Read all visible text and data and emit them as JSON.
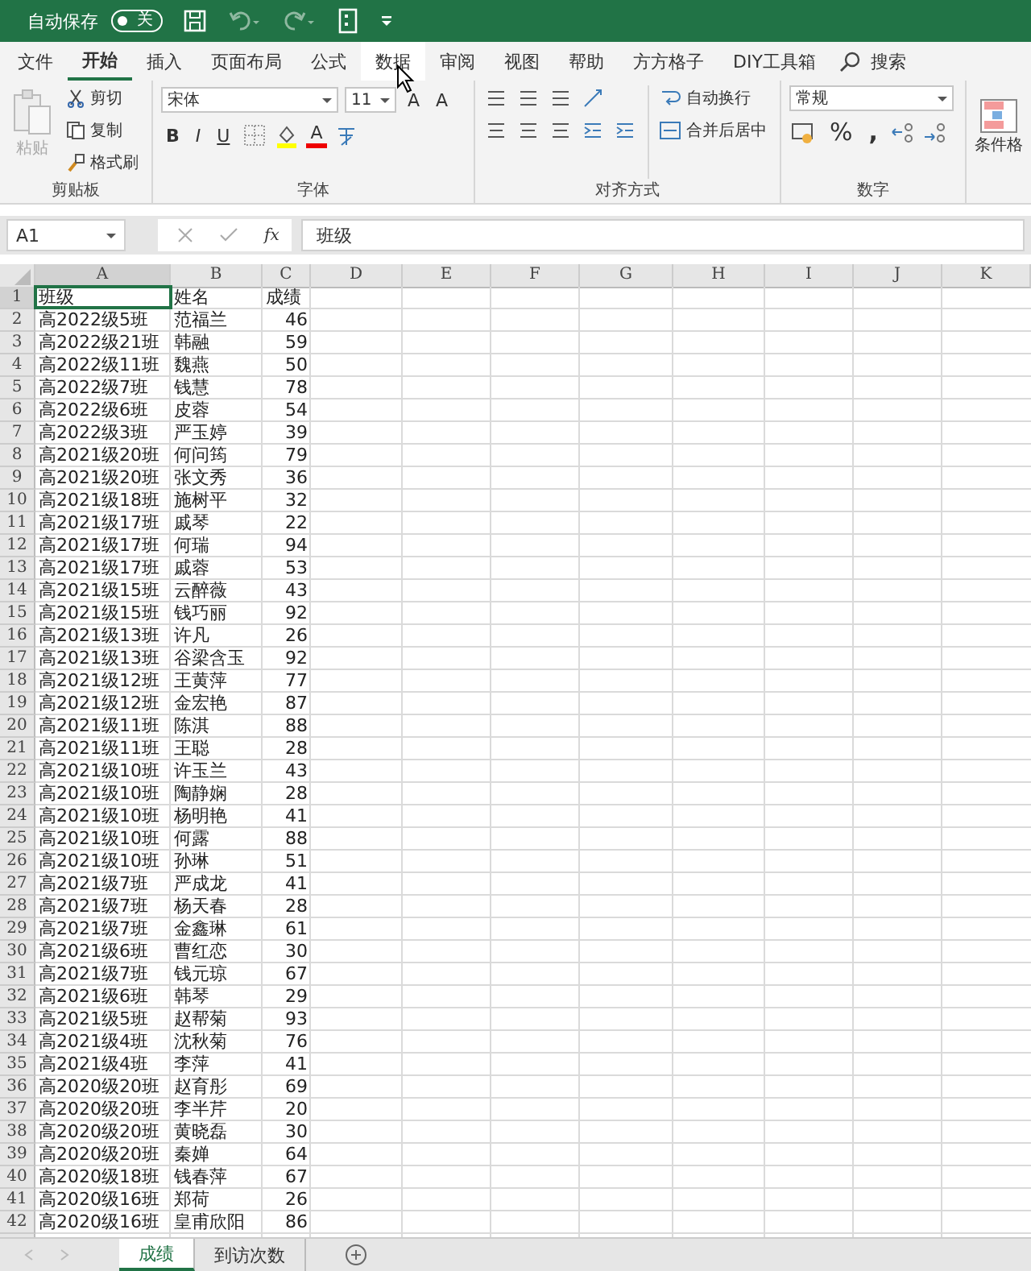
{
  "title_bar": {
    "autosave_label": "自动保存",
    "autosave_toggle": {
      "label": "关",
      "on": false
    }
  },
  "tabs": [
    {
      "label": "文件",
      "selected": false,
      "hovered": false
    },
    {
      "label": "开始",
      "selected": true,
      "hovered": false
    },
    {
      "label": "插入",
      "selected": false,
      "hovered": false
    },
    {
      "label": "页面布局",
      "selected": false,
      "hovered": false
    },
    {
      "label": "公式",
      "selected": false,
      "hovered": false
    },
    {
      "label": "数据",
      "selected": false,
      "hovered": true
    },
    {
      "label": "审阅",
      "selected": false,
      "hovered": false
    },
    {
      "label": "视图",
      "selected": false,
      "hovered": false
    },
    {
      "label": "帮助",
      "selected": false,
      "hovered": false
    },
    {
      "label": "方方格子",
      "selected": false,
      "hovered": false
    },
    {
      "label": "DIY工具箱",
      "selected": false,
      "hovered": false
    }
  ],
  "search": {
    "label": "搜索"
  },
  "clipboard": {
    "label": "剪贴板",
    "paste": "粘贴",
    "cut": "剪切",
    "copy": "复制",
    "format_painter": "格式刷"
  },
  "font": {
    "label": "字体",
    "font_name": "宋体",
    "font_size": "11",
    "grow": "A",
    "shrink": "A",
    "bold": "B",
    "italic": "I",
    "underline": "U",
    "font_color": "A"
  },
  "alignment": {
    "label": "对齐方式",
    "wrap_text": "自动换行",
    "merge_center": "合并后居中"
  },
  "number": {
    "label": "数字",
    "format": "常规",
    "percent": "%",
    "comma": ","
  },
  "styles": {
    "conditional_formatting": "条件格"
  },
  "formula_bar": {
    "name_box": "A1",
    "fx": "fx",
    "value": "班级"
  },
  "sheet": {
    "columns": [
      {
        "label": "A",
        "selected": true
      },
      {
        "label": "B",
        "selected": false
      },
      {
        "label": "C",
        "selected": false
      },
      {
        "label": "D",
        "selected": false
      },
      {
        "label": "E",
        "selected": false
      },
      {
        "label": "F",
        "selected": false
      },
      {
        "label": "G",
        "selected": false
      },
      {
        "label": "H",
        "selected": false
      },
      {
        "label": "I",
        "selected": false
      },
      {
        "label": "J",
        "selected": false
      },
      {
        "label": "K",
        "selected": false
      }
    ],
    "rows": [
      {
        "number": "1",
        "selected": true,
        "cells": [
          "班级",
          "姓名",
          "成绩"
        ]
      },
      {
        "number": "2",
        "selected": false,
        "cells": [
          "高2022级5班",
          "范福兰",
          "46"
        ]
      },
      {
        "number": "3",
        "selected": false,
        "cells": [
          "高2022级21班",
          "韩融",
          "59"
        ]
      },
      {
        "number": "4",
        "selected": false,
        "cells": [
          "高2022级11班",
          "魏燕",
          "50"
        ]
      },
      {
        "number": "5",
        "selected": false,
        "cells": [
          "高2022级7班",
          "钱慧",
          "78"
        ]
      },
      {
        "number": "6",
        "selected": false,
        "cells": [
          "高2022级6班",
          "皮蓉",
          "54"
        ]
      },
      {
        "number": "7",
        "selected": false,
        "cells": [
          "高2022级3班",
          "严玉婷",
          "39"
        ]
      },
      {
        "number": "8",
        "selected": false,
        "cells": [
          "高2021级20班",
          "何问筠",
          "79"
        ]
      },
      {
        "number": "9",
        "selected": false,
        "cells": [
          "高2021级20班",
          "张文秀",
          "36"
        ]
      },
      {
        "number": "10",
        "selected": false,
        "cells": [
          "高2021级18班",
          "施树平",
          "32"
        ]
      },
      {
        "number": "11",
        "selected": false,
        "cells": [
          "高2021级17班",
          "戚琴",
          "22"
        ]
      },
      {
        "number": "12",
        "selected": false,
        "cells": [
          "高2021级17班",
          "何瑞",
          "94"
        ]
      },
      {
        "number": "13",
        "selected": false,
        "cells": [
          "高2021级17班",
          "戚蓉",
          "53"
        ]
      },
      {
        "number": "14",
        "selected": false,
        "cells": [
          "高2021级15班",
          "云醉薇",
          "43"
        ]
      },
      {
        "number": "15",
        "selected": false,
        "cells": [
          "高2021级15班",
          "钱巧丽",
          "92"
        ]
      },
      {
        "number": "16",
        "selected": false,
        "cells": [
          "高2021级13班",
          "许凡",
          "26"
        ]
      },
      {
        "number": "17",
        "selected": false,
        "cells": [
          "高2021级13班",
          "谷梁含玉",
          "92"
        ]
      },
      {
        "number": "18",
        "selected": false,
        "cells": [
          "高2021级12班",
          "王黄萍",
          "77"
        ]
      },
      {
        "number": "19",
        "selected": false,
        "cells": [
          "高2021级12班",
          "金宏艳",
          "87"
        ]
      },
      {
        "number": "20",
        "selected": false,
        "cells": [
          "高2021级11班",
          "陈淇",
          "88"
        ]
      },
      {
        "number": "21",
        "selected": false,
        "cells": [
          "高2021级11班",
          "王聪",
          "28"
        ]
      },
      {
        "number": "22",
        "selected": false,
        "cells": [
          "高2021级10班",
          "许玉兰",
          "43"
        ]
      },
      {
        "number": "23",
        "selected": false,
        "cells": [
          "高2021级10班",
          "陶静娴",
          "28"
        ]
      },
      {
        "number": "24",
        "selected": false,
        "cells": [
          "高2021级10班",
          "杨明艳",
          "41"
        ]
      },
      {
        "number": "25",
        "selected": false,
        "cells": [
          "高2021级10班",
          "何露",
          "88"
        ]
      },
      {
        "number": "26",
        "selected": false,
        "cells": [
          "高2021级10班",
          "孙琳",
          "51"
        ]
      },
      {
        "number": "27",
        "selected": false,
        "cells": [
          "高2021级7班",
          "严成龙",
          "41"
        ]
      },
      {
        "number": "28",
        "selected": false,
        "cells": [
          "高2021级7班",
          "杨天春",
          "28"
        ]
      },
      {
        "number": "29",
        "selected": false,
        "cells": [
          "高2021级7班",
          "金鑫琳",
          "61"
        ]
      },
      {
        "number": "30",
        "selected": false,
        "cells": [
          "高2021级6班",
          "曹红恋",
          "30"
        ]
      },
      {
        "number": "31",
        "selected": false,
        "cells": [
          "高2021级7班",
          "钱元琼",
          "67"
        ]
      },
      {
        "number": "32",
        "selected": false,
        "cells": [
          "高2021级6班",
          "韩琴",
          "29"
        ]
      },
      {
        "number": "33",
        "selected": false,
        "cells": [
          "高2021级5班",
          "赵帮菊",
          "93"
        ]
      },
      {
        "number": "34",
        "selected": false,
        "cells": [
          "高2021级4班",
          "沈秋菊",
          "76"
        ]
      },
      {
        "number": "35",
        "selected": false,
        "cells": [
          "高2021级4班",
          "李萍",
          "41"
        ]
      },
      {
        "number": "36",
        "selected": false,
        "cells": [
          "高2020级20班",
          "赵育彤",
          "69"
        ]
      },
      {
        "number": "37",
        "selected": false,
        "cells": [
          "高2020级20班",
          "李半芹",
          "20"
        ]
      },
      {
        "number": "38",
        "selected": false,
        "cells": [
          "高2020级20班",
          "黄晓磊",
          "30"
        ]
      },
      {
        "number": "39",
        "selected": false,
        "cells": [
          "高2020级20班",
          "秦婵",
          "64"
        ]
      },
      {
        "number": "40",
        "selected": false,
        "cells": [
          "高2020级18班",
          "钱春萍",
          "67"
        ]
      },
      {
        "number": "41",
        "selected": false,
        "cells": [
          "高2020级16班",
          "郑荷",
          "26"
        ]
      },
      {
        "number": "42",
        "selected": false,
        "cells": [
          "高2020级16班",
          "皇甫欣阳",
          "86"
        ]
      }
    ]
  },
  "sheet_tabs": [
    {
      "label": "成绩",
      "selected": true
    },
    {
      "label": "到访次数",
      "selected": false
    }
  ]
}
